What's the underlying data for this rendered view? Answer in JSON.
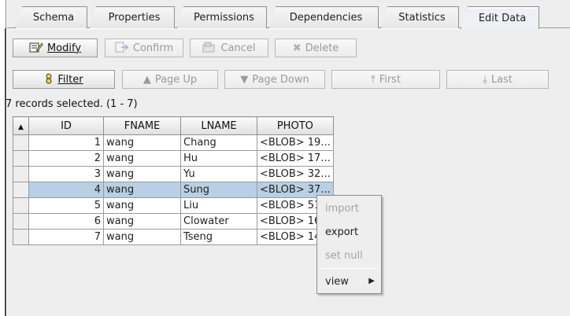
{
  "tabs": [
    {
      "label": "Schema"
    },
    {
      "label": "Properties"
    },
    {
      "label": "Permissions"
    },
    {
      "label": "Dependencies"
    },
    {
      "label": "Statistics"
    },
    {
      "label": "Edit Data"
    }
  ],
  "toolbar1": {
    "modify": "Modify",
    "confirm": "Confirm",
    "cancel": "Cancel",
    "delete": "Delete"
  },
  "toolbar2": {
    "filter": "Filter",
    "page_up": "Page Up",
    "page_down": "Page Down",
    "first": "First",
    "last": "Last"
  },
  "status": "7 records selected. (1 - 7)",
  "table": {
    "columns": [
      "ID",
      "FNAME",
      "LNAME",
      "PHOTO"
    ],
    "rows": [
      [
        "1",
        "wang",
        "Chang",
        "<BLOB> 19..."
      ],
      [
        "2",
        "wang",
        "Hu",
        "<BLOB> 17..."
      ],
      [
        "3",
        "wang",
        "Yu",
        "<BLOB> 32..."
      ],
      [
        "4",
        "wang",
        "Sung",
        "<BLOB> 37..."
      ],
      [
        "5",
        "wang",
        "Liu",
        "<BLOB> 51..."
      ],
      [
        "6",
        "wang",
        "Clowater",
        "<BLOB> 16..."
      ],
      [
        "7",
        "wang",
        "Tseng",
        "<BLOB> 14..."
      ]
    ]
  },
  "context_menu": {
    "import": "import",
    "export": "export",
    "set_null": "set null",
    "view": "view"
  },
  "colors": {
    "selection": "#b8cfe5",
    "panel": "#eeeeee"
  }
}
